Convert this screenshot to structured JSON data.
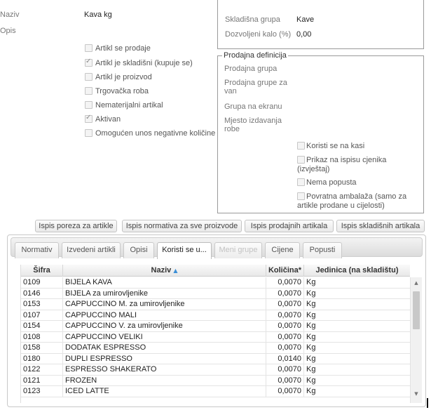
{
  "form": {
    "naziv_label": "Naziv",
    "naziv_value": "Kava kg",
    "opis_label": "Opis"
  },
  "flags": [
    {
      "label": "Artikl se prodaje",
      "checked": false
    },
    {
      "label": "Artikl je skladišni (kupuje se)",
      "checked": true
    },
    {
      "label": "Artikl je proizvod",
      "checked": false
    },
    {
      "label": "Trgovačka roba",
      "checked": false
    },
    {
      "label": "Nematerijalni artikal",
      "checked": false
    },
    {
      "label": "Aktivan",
      "checked": true
    },
    {
      "label": "Omogućen unos negativne količine",
      "checked": false
    }
  ],
  "stock_panel": {
    "group_label": "Skladišna grupa",
    "group_value": "Kave",
    "loss_label": "Dozvoljeni kalo (%)",
    "loss_value": "0,00"
  },
  "sales_panel": {
    "legend": "Prodajna definicija",
    "sales_group_label": "Prodajna grupa",
    "sales_group_out_label": "Prodajna grupe za van",
    "screen_group_label": "Grupa na ekranu",
    "issue_place_label": "Mjesto izdavanja robe",
    "options": [
      {
        "label": "Koristi se na kasi",
        "checked": false
      },
      {
        "label": "Prikaz na ispisu cjenika (izvještaj)",
        "checked": false
      },
      {
        "label": "Nema popusta",
        "checked": false
      },
      {
        "label": "Povratna ambalaža (samo za artikle prodane u cijelosti)",
        "checked": false
      }
    ]
  },
  "actions": {
    "print_tax": "Ispis poreza za artikle",
    "print_norms": "Ispis normativa za sve proizvode",
    "print_sales": "Ispis prodajnih artikala",
    "print_stock": "Ispis skladišnih artikala"
  },
  "tabs": [
    {
      "label": "Normativ",
      "state": "normal"
    },
    {
      "label": "Izvedeni artikli",
      "state": "normal"
    },
    {
      "label": "Opisi",
      "state": "normal"
    },
    {
      "label": "Koristi se u...",
      "state": "active"
    },
    {
      "label": "Meni grupe",
      "state": "disabled"
    },
    {
      "label": "Cijene",
      "state": "normal"
    },
    {
      "label": "Popusti",
      "state": "normal"
    }
  ],
  "grid": {
    "columns": {
      "code": "Šifra",
      "name": "Naziv",
      "sort_indicator": "▲",
      "qty": "Količina*",
      "unit": "Jedinica (na skladištu)"
    },
    "rows": [
      {
        "code": "0109",
        "name": "BIJELA KAVA",
        "qty": "0,0070",
        "unit": "Kg"
      },
      {
        "code": "0146",
        "name": "BIJELA za umirovljenike",
        "qty": "0,0070",
        "unit": "Kg"
      },
      {
        "code": "0153",
        "name": "CAPPUCCINO M. za umirovljenike",
        "qty": "0,0070",
        "unit": "Kg"
      },
      {
        "code": "0107",
        "name": "CAPPUCCINO MALI",
        "qty": "0,0070",
        "unit": "Kg"
      },
      {
        "code": "0154",
        "name": "CAPPUCCINO V. za umirovljenike",
        "qty": "0,0070",
        "unit": "Kg"
      },
      {
        "code": "0108",
        "name": "CAPPUCCINO VELIKI",
        "qty": "0,0070",
        "unit": "Kg"
      },
      {
        "code": "0158",
        "name": "DODATAK ESPRESSO",
        "qty": "0,0070",
        "unit": "Kg"
      },
      {
        "code": "0180",
        "name": "DUPLI ESPRESSO",
        "qty": "0,0140",
        "unit": "Kg"
      },
      {
        "code": "0122",
        "name": "ESPRESSO SHAKERATO",
        "qty": "0,0070",
        "unit": "Kg"
      },
      {
        "code": "0121",
        "name": "FROZEN",
        "qty": "0,0070",
        "unit": "Kg"
      },
      {
        "code": "0123",
        "name": "ICED LATTE",
        "qty": "0,0070",
        "unit": "Kg"
      }
    ]
  },
  "colors": {
    "sort_arrow": "#3b8fd6",
    "disabled_text": "#c2c2c2"
  }
}
